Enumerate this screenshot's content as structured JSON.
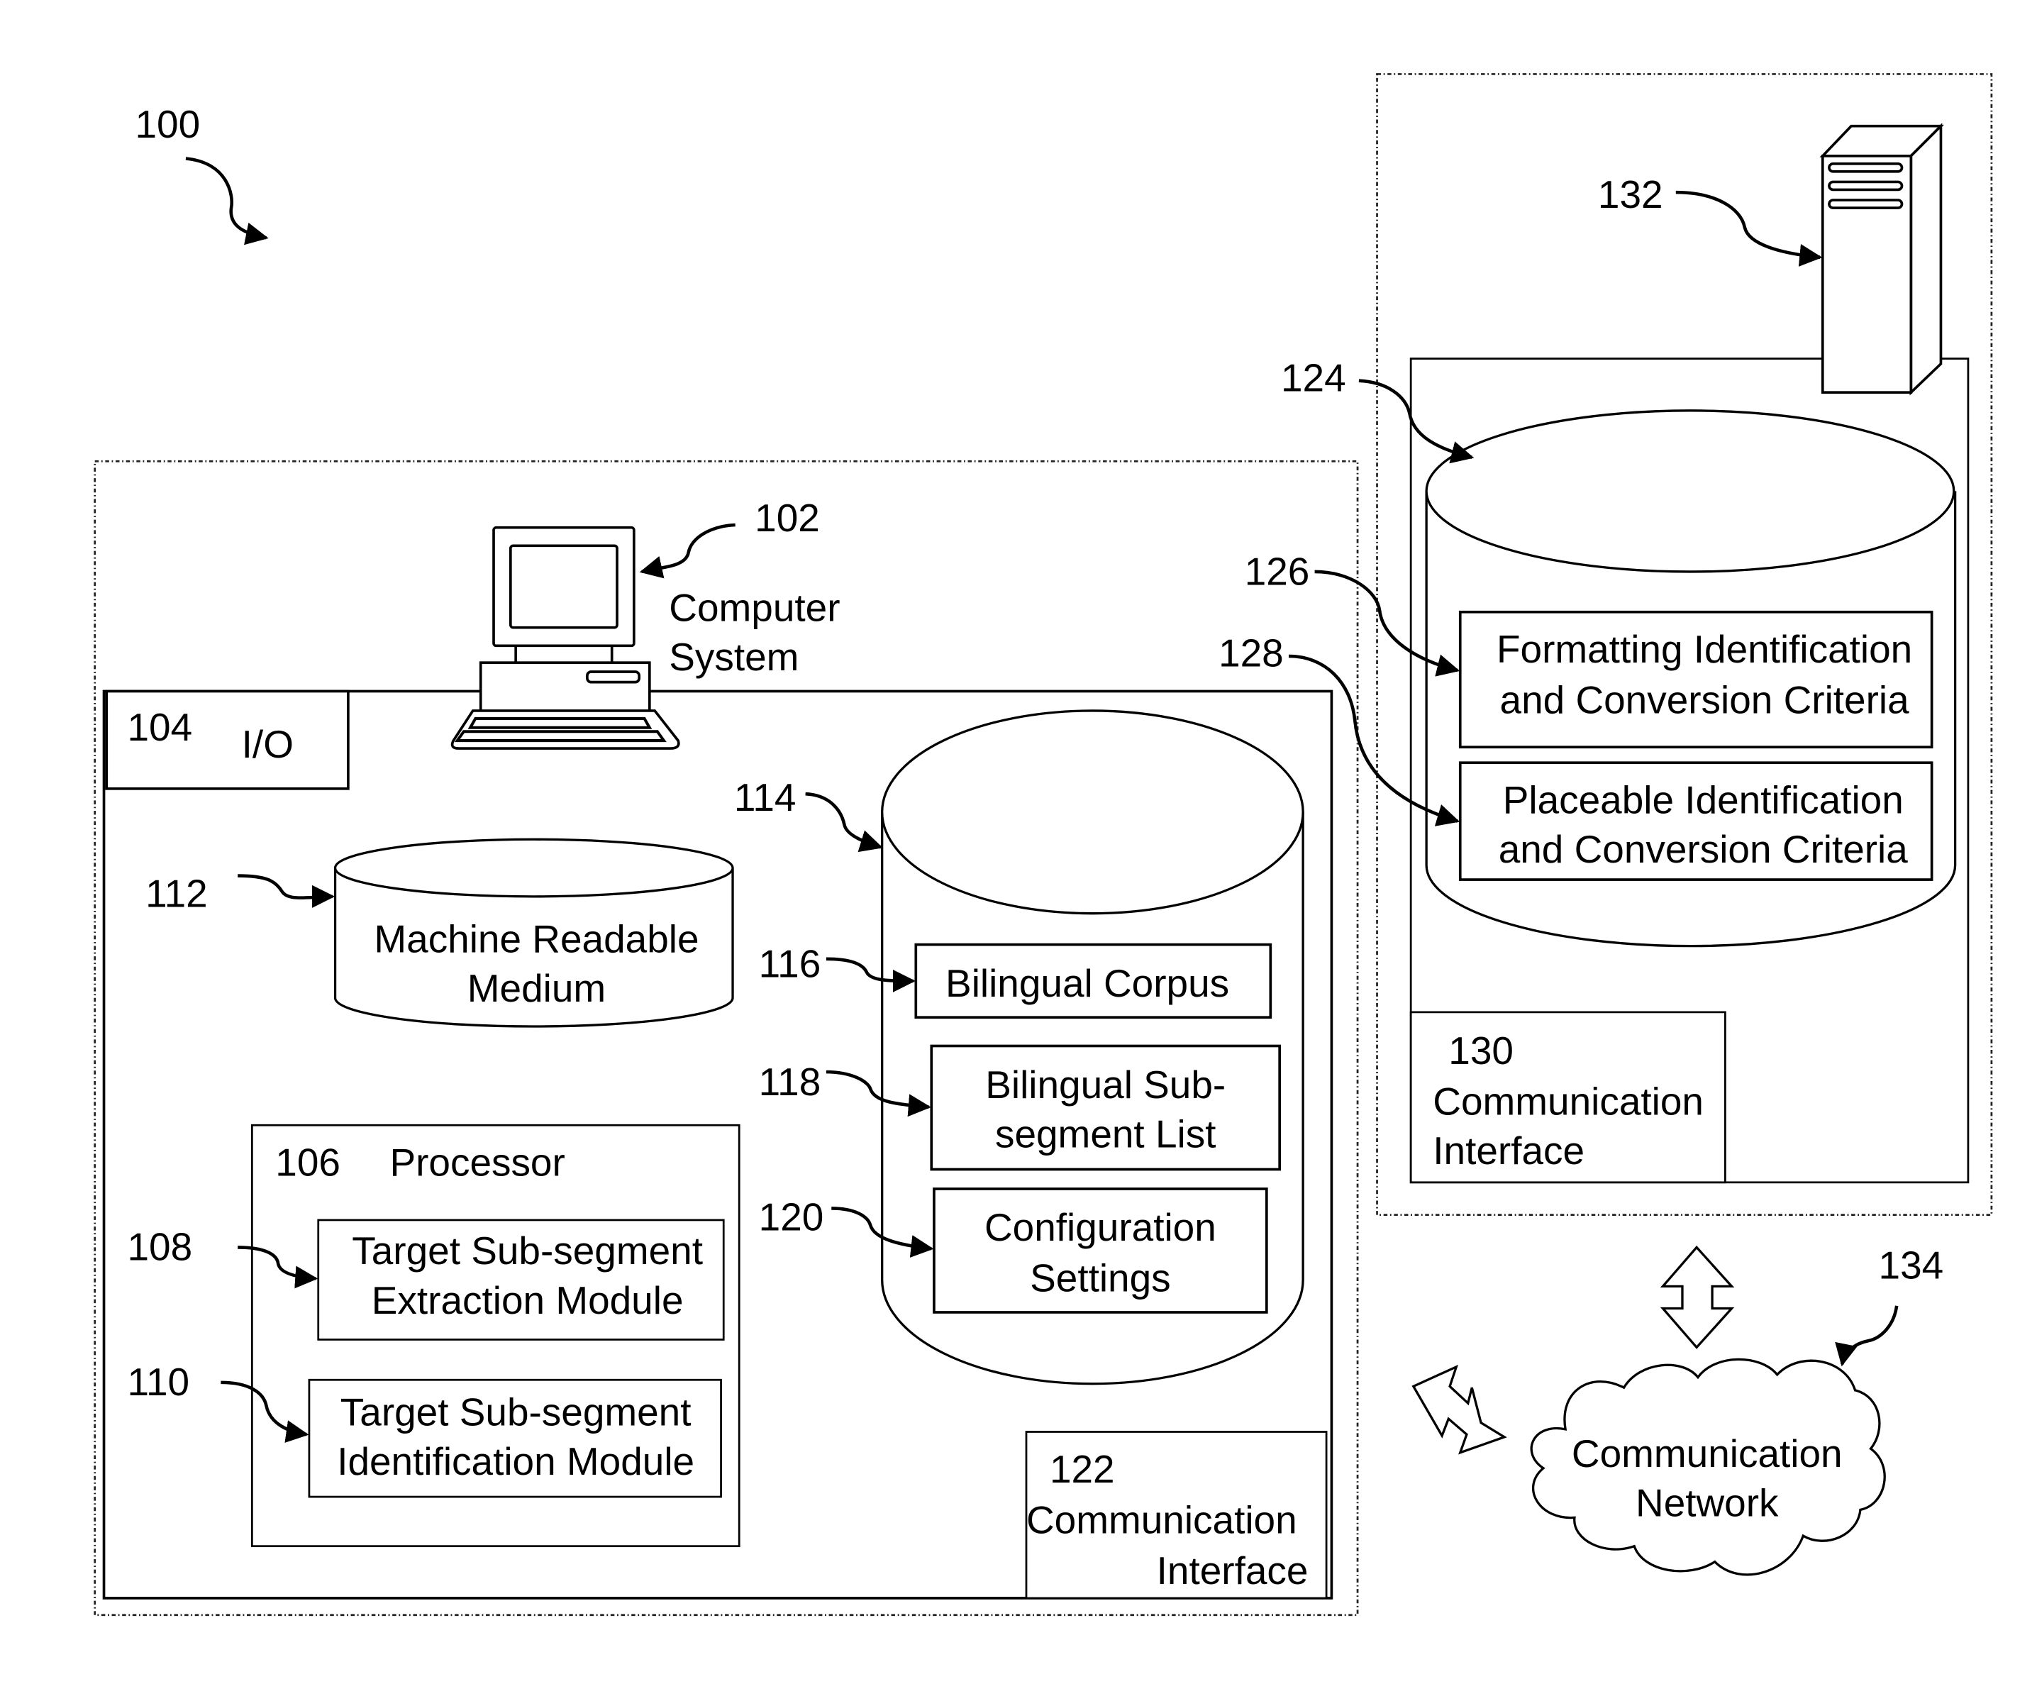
{
  "figure": {
    "ref": "100",
    "computer_system": {
      "ref": "102",
      "label_line1": "Computer",
      "label_line2": "System",
      "io": {
        "ref": "104",
        "label": "I/O"
      },
      "processor": {
        "ref": "106",
        "label": "Processor",
        "modules": [
          {
            "ref": "108",
            "line1": "Target Sub-segment",
            "line2": "Extraction Module"
          },
          {
            "ref": "110",
            "line1": "Target Sub-segment",
            "line2": "Identification Module"
          }
        ]
      },
      "machine_readable_medium": {
        "ref": "112",
        "line1": "Machine Readable",
        "line2": "Medium"
      },
      "database": {
        "ref": "114",
        "items": [
          {
            "ref": "116",
            "line1": "Bilingual Corpus",
            "line2": ""
          },
          {
            "ref": "118",
            "line1": "Bilingual Sub-",
            "line2": "segment List"
          },
          {
            "ref": "120",
            "line1": "Configuration",
            "line2": "Settings"
          }
        ]
      },
      "comm_interface": {
        "ref": "122",
        "line1": "Communication",
        "line2": "Interface"
      }
    },
    "server_system": {
      "server_ref": "132",
      "database": {
        "ref": "124",
        "items": [
          {
            "ref": "126",
            "line1": "Formatting Identification",
            "line2": "and Conversion Criteria"
          },
          {
            "ref": "128",
            "line1": "Placeable Identification",
            "line2": "and Conversion Criteria"
          }
        ]
      },
      "comm_interface": {
        "ref": "130",
        "line1": "Communication",
        "line2": "Interface"
      }
    },
    "network": {
      "ref": "134",
      "line1": "Communication",
      "line2": "Network"
    }
  }
}
